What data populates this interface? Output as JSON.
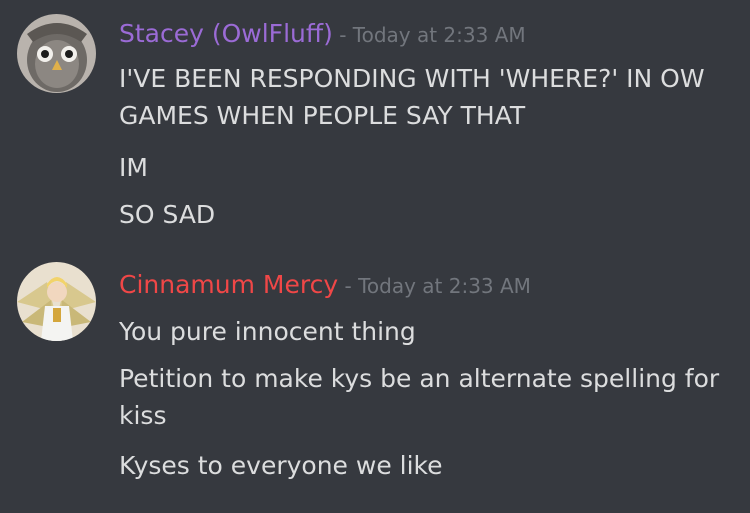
{
  "messages": [
    {
      "author": "Stacey (OwlFluff)",
      "separator": " - ",
      "timestamp": "Today at 2:33 AM",
      "author_color": "#9b6bd6",
      "avatar": "owl-avatar-icon",
      "lines": [
        "I'VE BEEN RESPONDING WITH 'WHERE?' IN OW GAMES WHEN PEOPLE SAY THAT",
        "IM",
        "SO SAD"
      ]
    },
    {
      "author": "Cinnamum Mercy",
      "separator": " - ",
      "timestamp": "Today at 2:33 AM",
      "author_color": "#f04747",
      "avatar": "mercy-avatar-icon",
      "lines": [
        "You pure innocent thing",
        "Petition to make kys be an alternate spelling for kiss",
        "Kyses to everyone we like"
      ]
    }
  ],
  "theme": {
    "background": "#36393f",
    "text": "#dcddde",
    "muted": "#72767d"
  }
}
